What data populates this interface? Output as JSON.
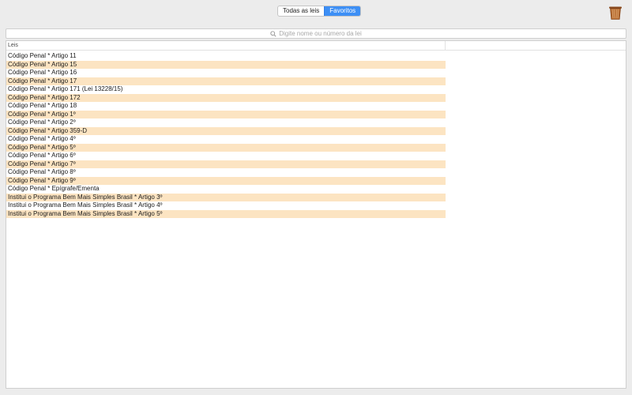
{
  "tabs": {
    "all_label": "Todas as leis",
    "favorites_label": "Favoritos",
    "selected": "favorites"
  },
  "toolbar": {
    "trash_icon": "trash-can-icon"
  },
  "search": {
    "placeholder": "Digite nome ou número da lei",
    "value": ""
  },
  "table": {
    "column_header": "Leis",
    "rows": [
      "Código Penal * Artigo 11",
      "Código Penal * Artigo 15",
      "Código Penal * Artigo 16",
      "Código Penal * Artigo 17",
      "Código Penal * Artigo 171 (Lei 13228/15)",
      "Código Penal * Artigo 172",
      "Código Penal * Artigo 18",
      "Código Penal * Artigo 1º",
      "Código Penal * Artigo 2º",
      "Código Penal * Artigo 359-D",
      "Código Penal * Artigo 4º",
      "Código Penal * Artigo 5º",
      "Código Penal * Artigo 6º",
      "Código Penal * Artigo 7º",
      "Código Penal * Artigo 8º",
      "Código Penal * Artigo 9º",
      "Código Penal * Epígrafe/Ementa",
      "Institui o Programa Bem Mais Simples Brasil * Artigo 3º",
      "Institui o Programa Bem Mais Simples Brasil * Artigo 4º",
      "Institui o Programa Bem Mais Simples Brasil * Artigo 5º"
    ]
  },
  "colors": {
    "accent": "#3d8ff5",
    "alt_row": "#fce4c2",
    "background": "#ececec"
  }
}
